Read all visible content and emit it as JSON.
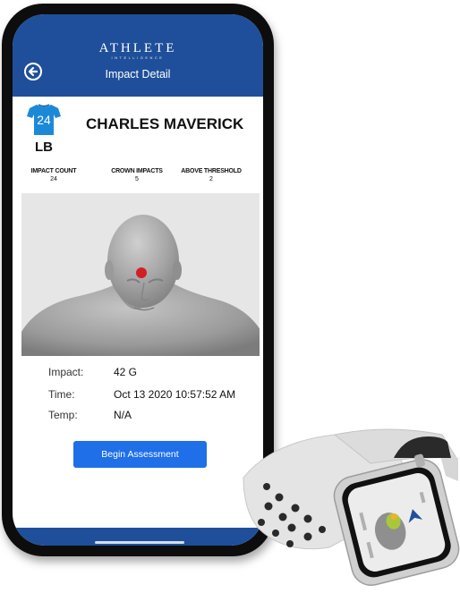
{
  "app": {
    "logo_text": "ATHLETE",
    "logo_subtext": "INTELLIGENCE",
    "screen_title": "Impact Detail"
  },
  "player": {
    "jersey_number": "24",
    "position": "LB",
    "name": "CHARLES MAVERICK"
  },
  "stats": [
    {
      "label": "IMPACT COUNT",
      "value": "24"
    },
    {
      "label": "CROWN IMPACTS",
      "value": "5"
    },
    {
      "label": "ABOVE THRESHOLD",
      "value": "2"
    }
  ],
  "impact_details": {
    "impact_label": "Impact:",
    "impact_value": "42 G",
    "time_label": "Time:",
    "time_value": "Oct 13 2020 10:57:52 AM",
    "temp_label": "Temp:",
    "temp_value": "N/A"
  },
  "actions": {
    "begin_assessment_label": "Begin Assessment"
  },
  "colors": {
    "header_blue": "#1f4f9a",
    "button_blue": "#1e6fe8",
    "impact_marker": "#d41e26"
  }
}
